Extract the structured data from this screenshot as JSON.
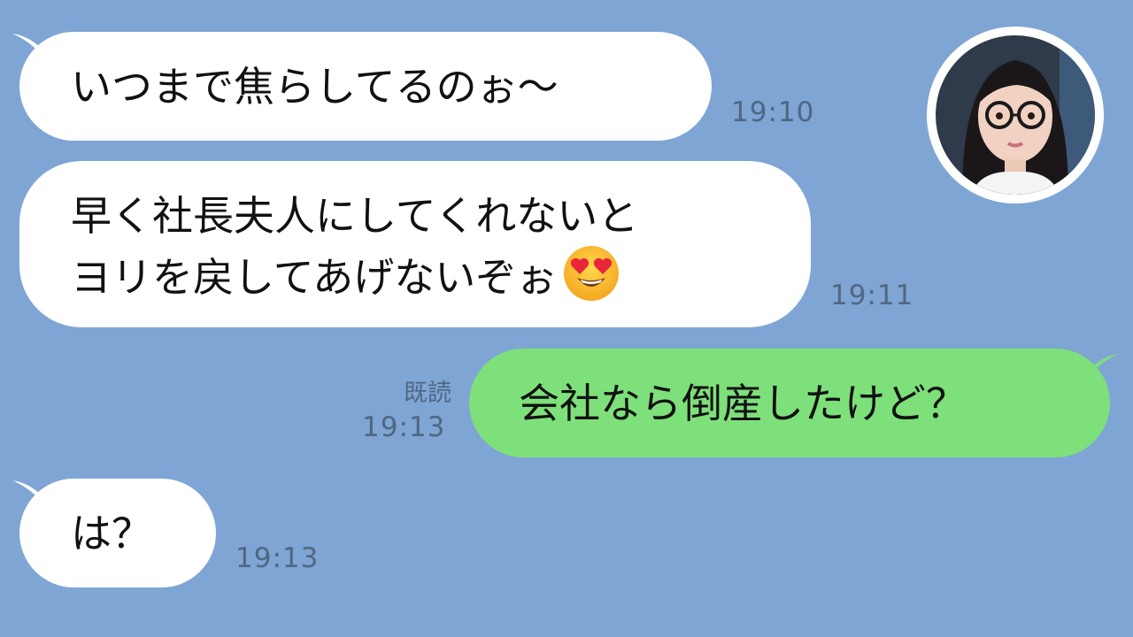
{
  "messages": [
    {
      "id": "m1",
      "side": "in",
      "text": "いつまで焦らしてるのぉ〜",
      "time": "19:10"
    },
    {
      "id": "m2",
      "side": "in",
      "lines": [
        "早く社長夫人にしてくれないと",
        "ヨリを戻してあげないぞぉ"
      ],
      "emoji": "smiling-face-with-heart-eyes",
      "time": "19:11"
    },
    {
      "id": "m3",
      "side": "out",
      "text": "会社なら倒産したけど？",
      "read_label": "既読",
      "time": "19:13"
    },
    {
      "id": "m4",
      "side": "in",
      "text": "は？",
      "time": "19:13"
    }
  ],
  "colors": {
    "background": "#7fa5d4",
    "incoming": "#ffffff",
    "outgoing": "#7ee07a",
    "meta_text": "#4f6783"
  },
  "avatar": {
    "icon": "avatar-woman-glasses"
  }
}
